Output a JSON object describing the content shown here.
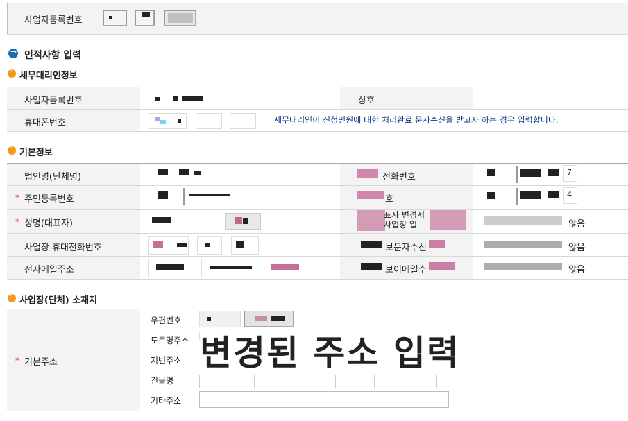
{
  "top": {
    "bizno_label": "사업자등록번호"
  },
  "title": "인적사항 입력",
  "agent": {
    "heading": "세무대리인정보",
    "bizno_label": "사업자등록번호",
    "company_label": "상호",
    "phone_label": "휴대폰번호",
    "notice": "세무대리인이 신청민원에 대한 처리완료 문자수신을 받고자 하는 경우 입력합니다."
  },
  "basic": {
    "heading": "기본정보",
    "rows": [
      {
        "label": "법인명(단체명)",
        "required": false,
        "right_label": "전화번호",
        "right_suffix": "7"
      },
      {
        "label": "주민등록번호",
        "required": true,
        "right_label": "호",
        "right_suffix": "4"
      },
      {
        "label": "성명(대표자)",
        "required": true,
        "right_label": "표자 변경서 사업장 일",
        "right_suffix": "않음"
      },
      {
        "label": "사업장 휴대전화번호",
        "required": false,
        "right_label": "보문자수신",
        "right_suffix": "않음"
      },
      {
        "label": "전자메일주소",
        "required": false,
        "right_label": "보이메일수",
        "right_suffix": "않음"
      }
    ]
  },
  "location": {
    "heading": "사업장(단체) 소재지",
    "main_label": "기본주소",
    "sub_labels": {
      "zip": "우편번호",
      "road": "도로명주소",
      "lot": "지번주소",
      "building": "건물명",
      "etc": "기타주소"
    },
    "overlay_text": "변경된 주소 입력"
  },
  "colors": {
    "circle_blue": "#1f6fb5",
    "circle_orange": "#f09a1a",
    "required_star": "#d62b2b"
  }
}
